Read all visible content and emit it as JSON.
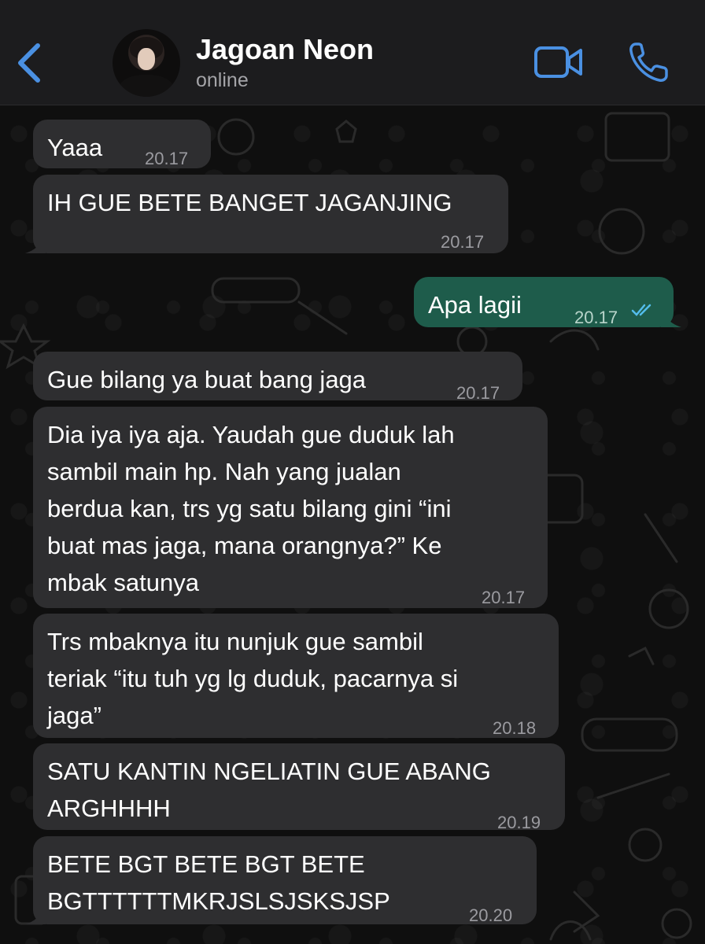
{
  "header": {
    "contact_name": "Jagoan Neon",
    "status": "online",
    "back_icon": "chevron-left-icon",
    "video_icon": "video-camera-icon",
    "call_icon": "phone-icon",
    "accent_color": "#4a90e2"
  },
  "messages": [
    {
      "direction": "in",
      "text": "Yaaa",
      "time": "20.17"
    },
    {
      "direction": "in",
      "text": "IH GUE BETE BANGET JAGANJING",
      "time": "20.17"
    },
    {
      "direction": "out",
      "text": "Apa lagii",
      "time": "20.17",
      "status": "read"
    },
    {
      "direction": "in",
      "text": "Gue bilang ya buat bang jaga",
      "time": "20.17"
    },
    {
      "direction": "in",
      "text": "Dia iya iya aja. Yaudah gue duduk lah\nsambil main hp. Nah yang jualan\nberdua kan, trs yg satu bilang gini “ini\nbuat mas jaga, mana orangnya?” Ke\nmbak satunya",
      "time": "20.17"
    },
    {
      "direction": "in",
      "text": "Trs mbaknya itu nunjuk gue sambil\nteriak “itu tuh yg lg duduk, pacarnya si\njaga”",
      "time": "20.18"
    },
    {
      "direction": "in",
      "text": "SATU KANTIN NGELIATIN GUE ABANG\nARGHHHH",
      "time": "20.19"
    },
    {
      "direction": "in",
      "text": "BETE BGT BETE BGT BETE\nBGTTTTTTMKRJSLSJSKSJSP",
      "time": "20.20"
    }
  ],
  "colors": {
    "incoming_bubble": "#2e2e30",
    "outgoing_bubble": "#1e5c4b",
    "read_ticks": "#53bdeb"
  }
}
